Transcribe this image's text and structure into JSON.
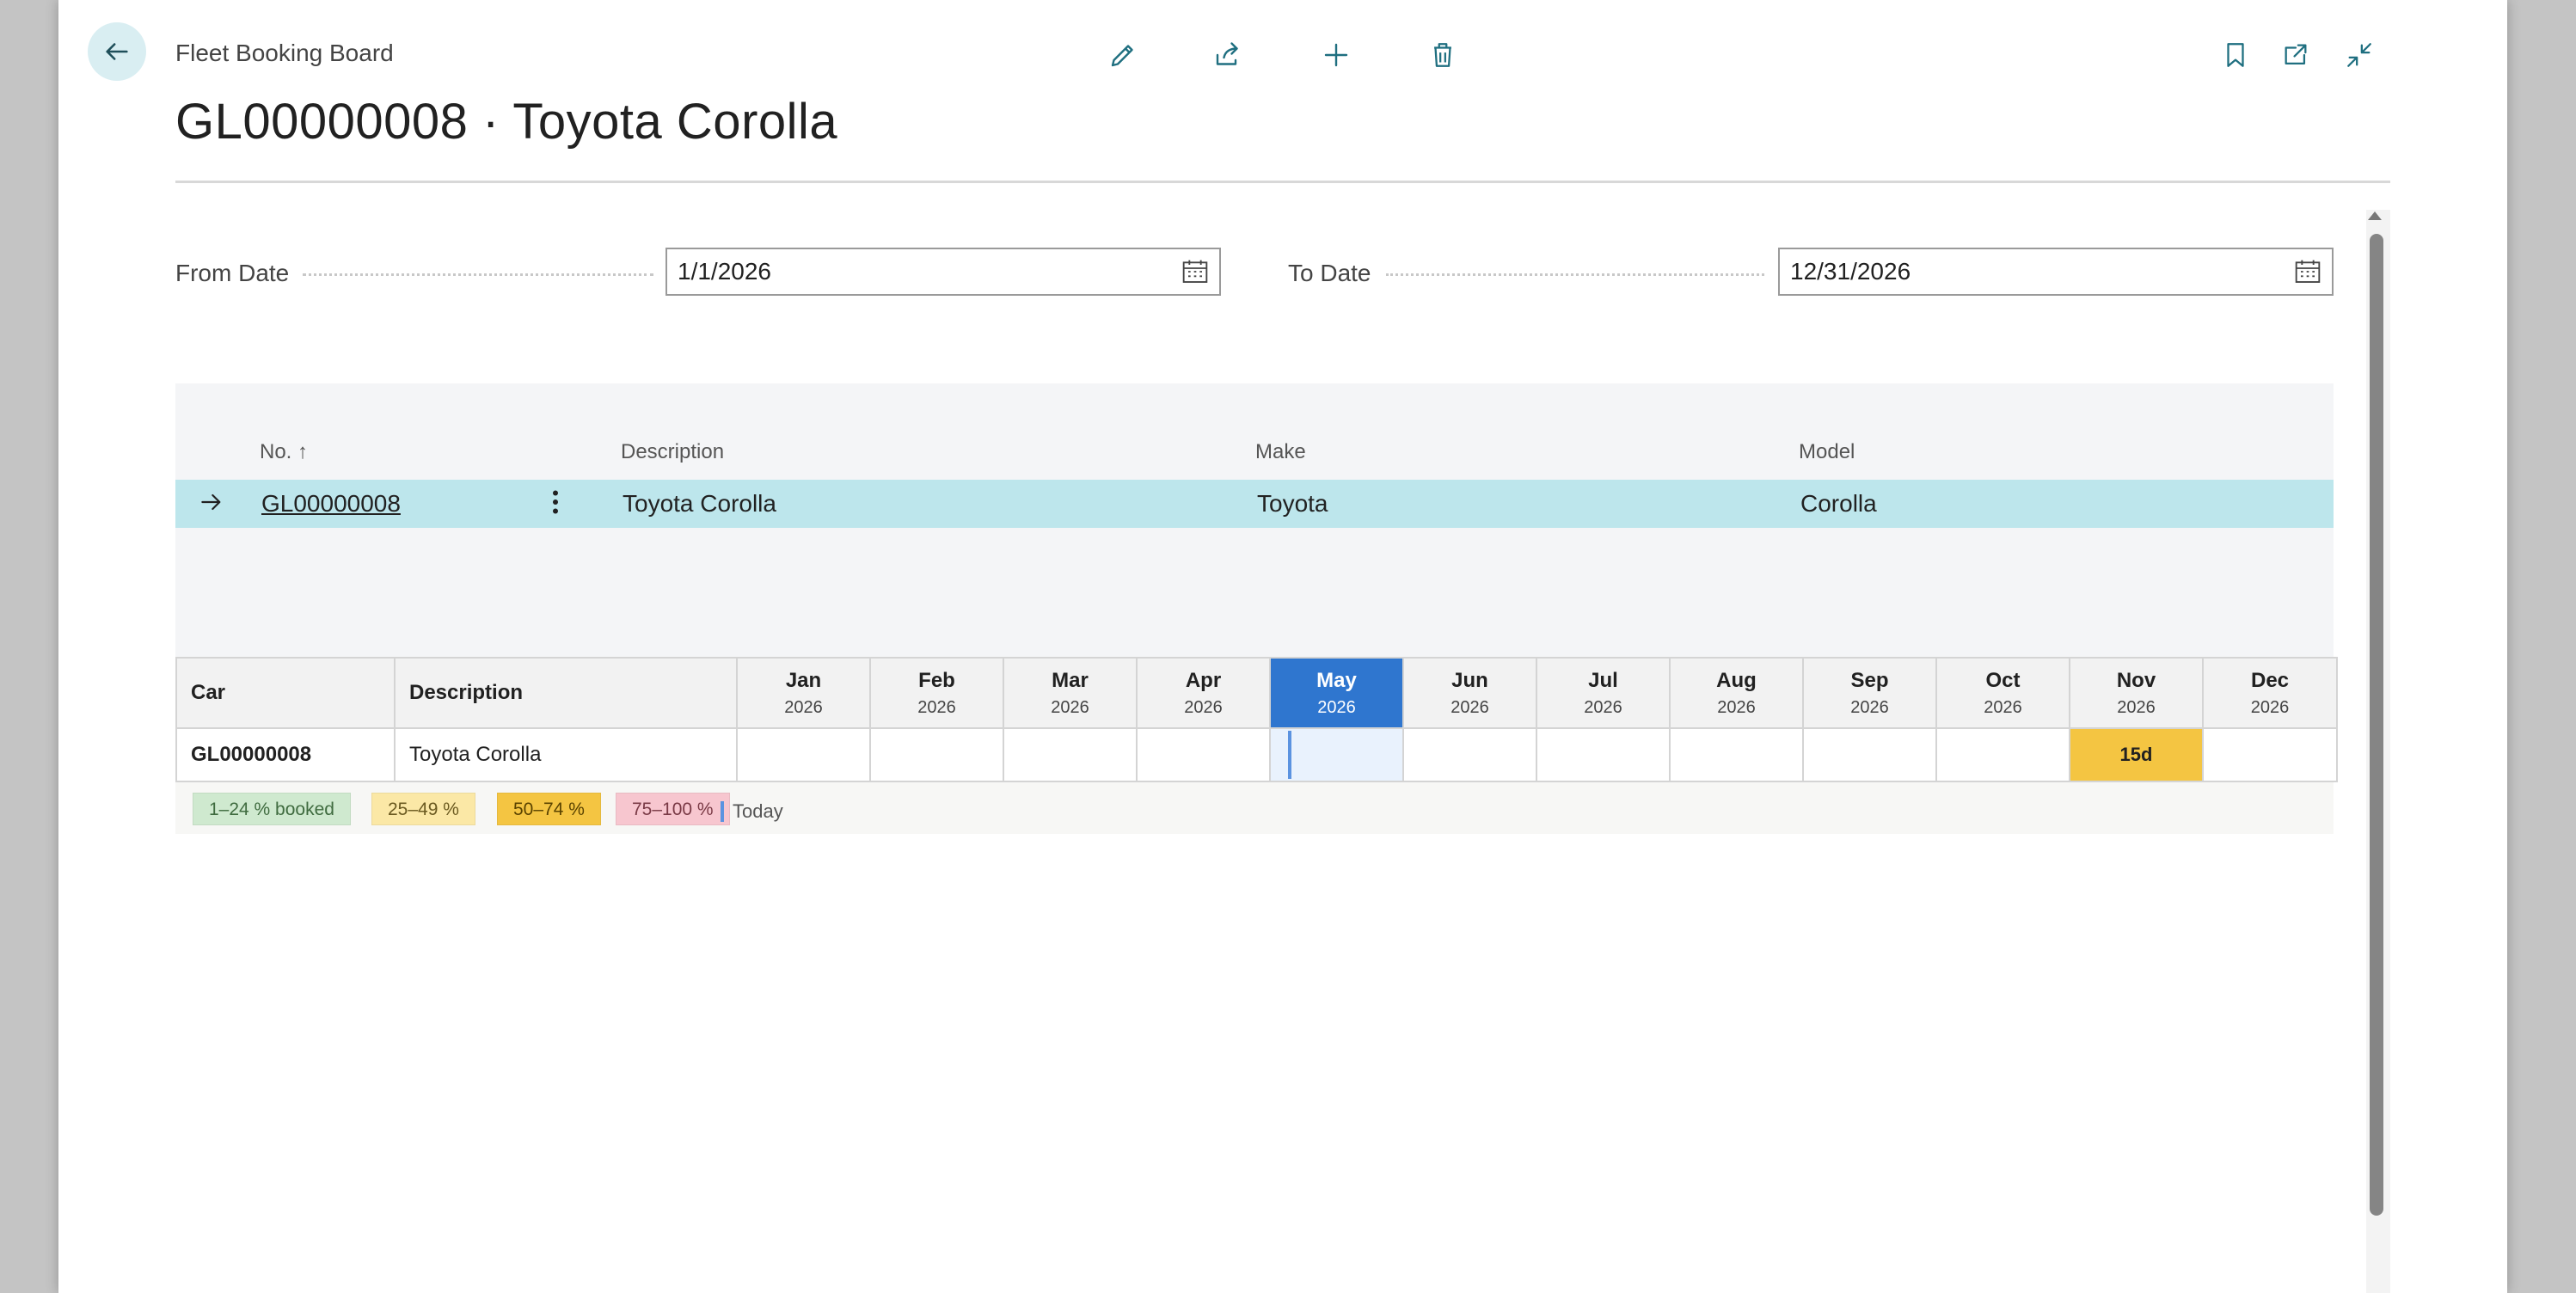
{
  "header": {
    "breadcrumb": "Fleet Booking Board",
    "title": "GL00000008 · Toyota Corolla"
  },
  "toolbar": {
    "icons": [
      "edit-icon",
      "share-icon",
      "add-icon",
      "delete-icon"
    ],
    "right_icons": [
      "bookmark-icon",
      "open-new-window-icon",
      "collapse-icon"
    ]
  },
  "filters": {
    "from_label": "From Date",
    "from_value": "1/1/2026",
    "to_label": "To Date",
    "to_value": "12/31/2026"
  },
  "list": {
    "columns": {
      "no": "No.",
      "sort_indicator": "↑",
      "description": "Description",
      "make": "Make",
      "model": "Model"
    },
    "row": {
      "no": "GL00000008",
      "description": "Toyota Corolla",
      "make": "Toyota",
      "model": "Corolla"
    }
  },
  "board": {
    "car_header": "Car",
    "desc_header": "Description",
    "months": [
      {
        "m": "Jan",
        "y": "2026"
      },
      {
        "m": "Feb",
        "y": "2026"
      },
      {
        "m": "Mar",
        "y": "2026"
      },
      {
        "m": "Apr",
        "y": "2026"
      },
      {
        "m": "May",
        "y": "2026"
      },
      {
        "m": "Jun",
        "y": "2026"
      },
      {
        "m": "Jul",
        "y": "2026"
      },
      {
        "m": "Aug",
        "y": "2026"
      },
      {
        "m": "Sep",
        "y": "2026"
      },
      {
        "m": "Oct",
        "y": "2026"
      },
      {
        "m": "Nov",
        "y": "2026"
      },
      {
        "m": "Dec",
        "y": "2026"
      }
    ],
    "current_month": "May",
    "row": {
      "car": "GL00000008",
      "description": "Toyota Corolla",
      "booking_month": "Nov",
      "booking_label": "15d"
    }
  },
  "legend": {
    "items": [
      {
        "label": "1–24 % booked",
        "color": "#cfe9cf",
        "text": "#3f6b3f"
      },
      {
        "label": "25–49 %",
        "color": "#fbe8a6",
        "text": "#6b5a20"
      },
      {
        "label": "50–74 %",
        "color": "#f4c542",
        "text": "#5a4300"
      },
      {
        "label": "75–100 %",
        "color": "#f7c6cf",
        "text": "#7a3a46"
      }
    ],
    "today": "Today"
  },
  "colors": {
    "accent": "#2f76cf",
    "selected_row": "#bde6ec",
    "icon_teal": "#1f6f80"
  }
}
